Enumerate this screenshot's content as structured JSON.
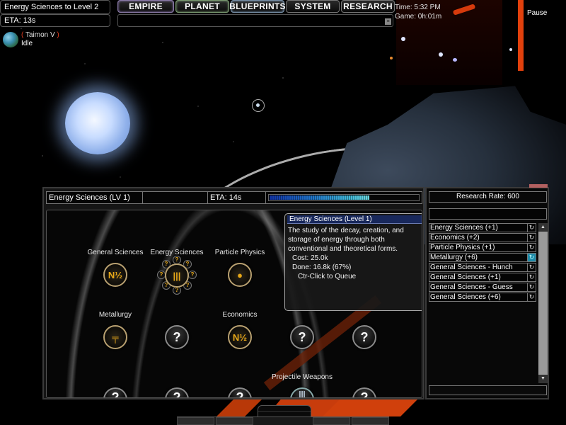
{
  "hud": {
    "queue_title": "Energy Sciences to Level 2",
    "queue_eta": "ETA: 13s",
    "planet": {
      "name": "Taimon V",
      "paren_open": "(",
      "paren_close": ")",
      "status": "Idle"
    },
    "nav": [
      "EMPIRE",
      "PLANET",
      "BLUEPRINTS",
      "SYSTEM",
      "RESEARCH"
    ],
    "time": "Time: 5:32 PM",
    "game_time": "Game: 0h:01m",
    "pause": "Pause"
  },
  "research": {
    "header": {
      "name": "Energy Sciences (LV 1)",
      "blank": "",
      "eta": "ETA: 14s",
      "progress_percent": 67
    },
    "tooltip": {
      "title": "Energy Sciences (Level 1)",
      "description": "The study of the decay, creation, and storage of energy through both conventional and theoretical forms.",
      "cost": "Cost: 25.0k",
      "done": "Done: 16.8k (67%)",
      "hint": "Ctr-Click to Queue"
    },
    "techs": [
      {
        "label": "General Sciences",
        "state": "known",
        "icon": "general-sciences-icon",
        "glyph": "N½"
      },
      {
        "label": "Energy Sciences",
        "state": "researching",
        "icon": "energy-sciences-icon",
        "glyph": "|||"
      },
      {
        "label": "Particle Physics",
        "state": "known",
        "icon": "particle-physics-icon",
        "glyph": "●"
      },
      {
        "label": "Metallurgy",
        "state": "known",
        "icon": "metallurgy-icon",
        "glyph": "╤"
      },
      {
        "label": "",
        "state": "unknown",
        "glyph": "?"
      },
      {
        "label": "Economics",
        "state": "known",
        "icon": "economics-icon",
        "glyph": "N½"
      },
      {
        "label": "",
        "state": "unknown",
        "glyph": "?"
      },
      {
        "label": "",
        "state": "unknown",
        "glyph": "?"
      },
      {
        "label": "Projectile Weapons",
        "state": "known",
        "icon": "projectile-weapons-icon",
        "glyph": "|||"
      },
      {
        "label": "",
        "state": "unknown",
        "glyph": "?"
      }
    ],
    "orbit_glyph": "?"
  },
  "queue": {
    "rate": "Research Rate: 600",
    "search_value": "",
    "items": [
      {
        "label": "Energy Sciences (+1)",
        "active": false
      },
      {
        "label": "Economics (+2)",
        "active": false
      },
      {
        "label": "Particle Physics (+1)",
        "active": false
      },
      {
        "label": "Metallurgy (+6)",
        "active": true
      },
      {
        "label": "General Sciences - Hunch",
        "active": false
      },
      {
        "label": "General Sciences (+1)",
        "active": false
      },
      {
        "label": "General Sciences - Guess",
        "active": false
      },
      {
        "label": "General Sciences (+6)",
        "active": false
      }
    ],
    "repeat_glyph": "↻",
    "scroll_up": "▲",
    "scroll_down": "▼"
  }
}
